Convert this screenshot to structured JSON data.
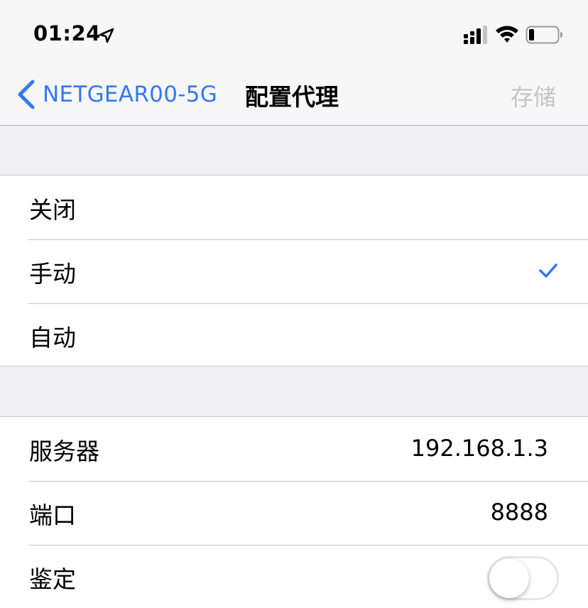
{
  "status_bar": {
    "time": "01:24"
  },
  "nav": {
    "back_label": "NETGEAR00-5G",
    "title": "配置代理",
    "save_label": "存储"
  },
  "proxy_modes": [
    {
      "label": "关闭",
      "selected": false
    },
    {
      "label": "手动",
      "selected": true
    },
    {
      "label": "自动",
      "selected": false
    }
  ],
  "manual_settings": {
    "server_label": "服务器",
    "server_value": "192.168.1.3",
    "port_label": "端口",
    "port_value": "8888",
    "auth_label": "鉴定",
    "auth_enabled": false
  },
  "colors": {
    "accent": "#3478f6",
    "disabled": "#c4c4c6",
    "grouped_background": "#efeff4"
  }
}
